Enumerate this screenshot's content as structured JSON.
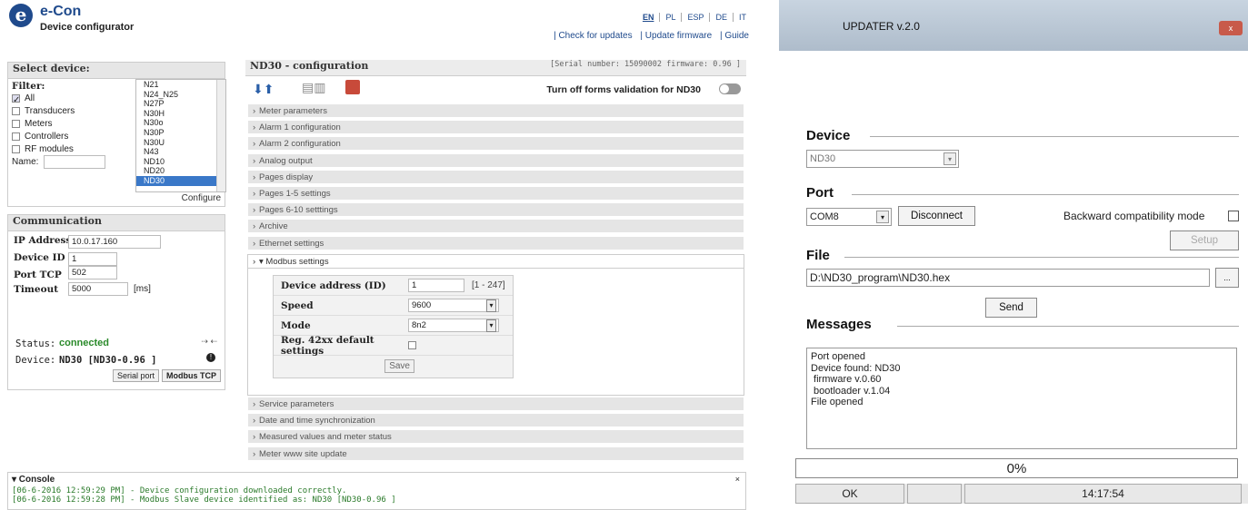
{
  "app": {
    "brand": "e-Con",
    "subtitle": "Device configurator",
    "logo_letter": "e",
    "logo_small": "CON",
    "languages": [
      "EN",
      "PL",
      "ESP",
      "DE",
      "IT"
    ],
    "top_links": [
      "| Check for updates",
      "| Update firmware",
      "| Guide"
    ]
  },
  "select_device": {
    "title": "Select device:",
    "filter_label": "Filter:",
    "filters": [
      {
        "label": "All",
        "checked": true
      },
      {
        "label": "Transducers",
        "checked": false
      },
      {
        "label": "Meters",
        "checked": false
      },
      {
        "label": "Controllers",
        "checked": false
      },
      {
        "label": "RF modules",
        "checked": false
      }
    ],
    "name_label": "Name:",
    "devices": [
      "N21",
      "N24_N25",
      "N27P",
      "N30H",
      "N30o",
      "N30P",
      "N30U",
      "N43",
      "ND10",
      "ND20",
      "ND30"
    ],
    "selected": "ND30",
    "configure": "Configure"
  },
  "communication": {
    "title": "Communication",
    "ip_label": "IP Address",
    "ip": "10.0.17.160",
    "id_label": "Device ID",
    "id": "1",
    "port_label": "Port TCP",
    "port": "502",
    "timeout_label": "Timeout",
    "timeout": "5000",
    "timeout_unit": "[ms]",
    "status_label": "Status:",
    "status": "connected",
    "device_label": "Device:",
    "device": "ND30 [ND30-0.96 ]",
    "serial_btn": "Serial port",
    "modbus_btn": "Modbus TCP"
  },
  "config": {
    "title": "ND30 - configuration",
    "serial_info": "[Serial number: 15090002 firmware: 0.96 ]",
    "validation_label": "Turn off forms validation for ND30",
    "sections_top": [
      "Meter parameters",
      "Alarm 1 configuration",
      "Alarm 2 configuration",
      "Analog output",
      "Pages display",
      "Pages 1-5 settings",
      "Pages 6-10 setttings",
      "Archive",
      "Ethernet settings"
    ],
    "modbus_title": "▾ Modbus settings",
    "modbus": {
      "addr_label": "Device address (ID)",
      "addr": "1",
      "addr_range": "[1 - 247]",
      "speed_label": "Speed",
      "speed": "9600",
      "mode_label": "Mode",
      "mode": "8n2",
      "reg_label": "Reg. 42xx default settings",
      "save": "Save"
    },
    "sections_bottom": [
      "Service parameters",
      "Date and time synchronization",
      "Measured values and meter status",
      "Meter www site update"
    ]
  },
  "console": {
    "title": "▾ Console",
    "lines": [
      "[06-6-2016 12:59:29 PM] - Device configuration downloaded correctly.",
      "[06-6-2016 12:59:28 PM] - Modbus Slave device identified as: ND30 [ND30-0.96 ]"
    ]
  },
  "updater": {
    "title": "UPDATER v.2.0",
    "close": "x",
    "device_label": "Device",
    "device": "ND30",
    "port_label": "Port",
    "port": "COM8",
    "disconnect": "Disconnect",
    "backward": "Backward compatibility mode",
    "setup": "Setup",
    "file_label": "File",
    "file": "D:\\ND30_program\\ND30.hex",
    "browse": "...",
    "send": "Send",
    "messages_label": "Messages",
    "messages": [
      "Port opened",
      "Device found: ND30",
      " firmware v.0.60",
      " bootloader v.1.04",
      "File opened"
    ],
    "progress": "0%",
    "status_ok": "OK",
    "time": "14:17:54"
  }
}
